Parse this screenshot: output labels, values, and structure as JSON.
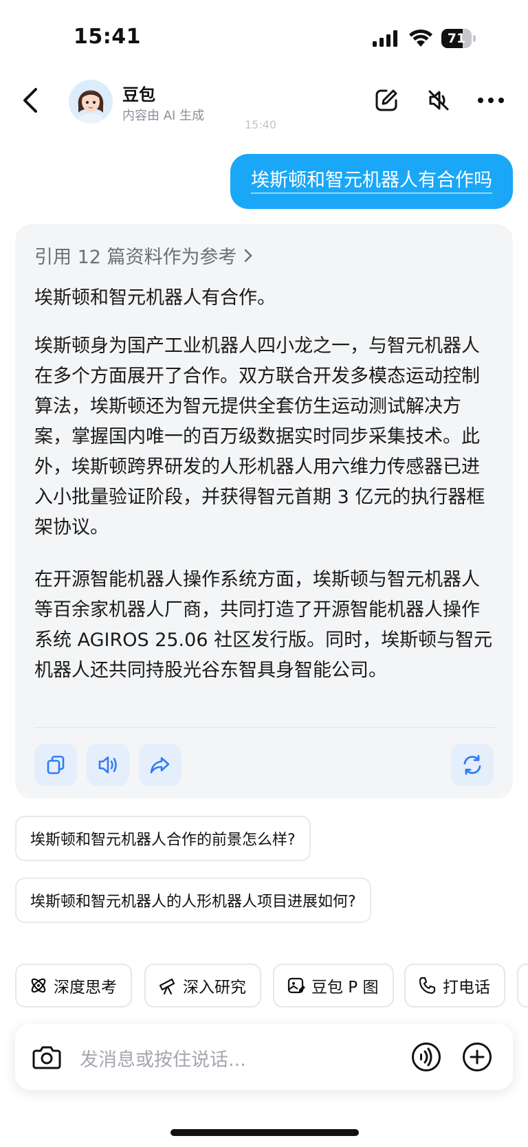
{
  "status_bar": {
    "time": "15:41",
    "battery": "71",
    "battery_level": 0.71
  },
  "header": {
    "title": "豆包",
    "subtitle": "内容由 AI 生成",
    "ghost_time": "15:40",
    "icons": [
      "back-icon",
      "edit-icon",
      "mute-icon",
      "more-icon"
    ]
  },
  "user_message": "埃斯顿和智元机器人有合作吗",
  "answer": {
    "reference": "引用 12 篇资料作为参考",
    "paragraphs": [
      "埃斯顿和智元机器人有合作。",
      "埃斯顿身为国产工业机器人四小龙之一，与智元机器人在多个方面展开了合作。双方联合开发多模态运动控制算法，埃斯顿还为智元提供全套仿生运动测试解决方案，掌握国内唯一的百万级数据实时同步采集技术。此外，埃斯顿跨界研发的人形机器人用六维力传感器已进入小批量验证阶段，并获得智元首期 3 亿元的执行器框架协议。",
      "在开源智能机器人操作系统方面，埃斯顿与智元机器人等百余家机器人厂商，共同打造了开源智能机器人操作系统 AGIROS 25.06 社区发行版。同时，埃斯顿与智元机器人还共同持股光谷东智具身智能公司。"
    ],
    "actions": [
      "copy-icon",
      "speaker-icon",
      "share-icon",
      "regenerate-icon"
    ]
  },
  "suggestions": [
    "埃斯顿和智元机器人合作的前景怎么样?",
    "埃斯顿和智元机器人的人形机器人项目进展如何?"
  ],
  "chips": [
    {
      "label": "深度思考",
      "icon": "atom-icon"
    },
    {
      "label": "深入研究",
      "icon": "telescope-icon"
    },
    {
      "label": "豆包 P 图",
      "icon": "image-edit-icon"
    },
    {
      "label": "打电话",
      "icon": "phone-icon"
    }
  ],
  "input": {
    "placeholder": "发消息或按住说话..."
  },
  "colors": {
    "accent": "#1aa7f7",
    "card_bg": "#f4f5f7",
    "action_blue": "#2f7cf6"
  }
}
